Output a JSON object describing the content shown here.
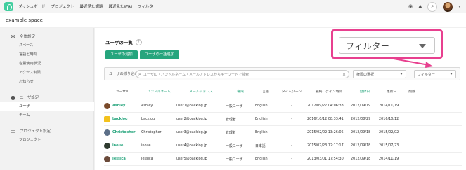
{
  "topnav": {
    "items": [
      "ダッシュボード",
      "プロジェクト",
      "最近見た課題",
      "最近見たWiki",
      "フィルタ"
    ],
    "right_icons": [
      "more-icon",
      "eye-icon",
      "bell-icon",
      "search-icon",
      "avatar"
    ]
  },
  "space": {
    "name": "example space"
  },
  "sidebar": {
    "sections": [
      {
        "label": "全体設定",
        "icon": "gear-icon",
        "items": [
          "スペース",
          "言語と時刻",
          "容量使用状況",
          "アクセス制限",
          "お知らせ"
        ]
      },
      {
        "label": "ユーザ設定",
        "icon": "user-icon",
        "items": [
          "ユーザ",
          "チーム"
        ]
      },
      {
        "label": "プロジェクト設定",
        "icon": "monitor-icon",
        "items": [
          "プロジェクト"
        ]
      }
    ],
    "active_item": "ユーザ"
  },
  "main": {
    "title": "ユーザの一覧",
    "help": "?",
    "buttons": {
      "add": "ユーザの追加",
      "bulk_add": "ユーザの一括追加"
    },
    "filter": {
      "label": "ユーザの絞り込み",
      "placeholder": "ユーザID・ハンドルネーム・メールアドレスからキーワードで検索",
      "clear": "×",
      "select1": "権限の選択",
      "select2": "フィルター"
    },
    "table": {
      "headers": [
        "ユーザID",
        "ハンドルネーム",
        "メールアドレス",
        "権限",
        "言語",
        "タイムゾーン",
        "最終ログイン時間",
        "登録日",
        "更新日",
        "削除"
      ],
      "rows": [
        [
          "Ashley",
          "Ashley",
          "user1@backlog.jp",
          "一般ユーザ",
          "English",
          "-",
          "2012/09/27 04:06:33",
          "2012/09/19",
          "2014/11/19",
          ""
        ],
        [
          "backlog",
          "backlog",
          "user2@backlog.jp",
          "管理者",
          "English",
          "-",
          "2016/10/12 08:33:41",
          "2012/08/29",
          "2016/10/12",
          ""
        ],
        [
          "Christopher",
          "Christopher",
          "user3@backlog.jp",
          "管理者",
          "English",
          "-",
          "2015/02/02 13:26:05",
          "2012/09/18",
          "2015/02/02",
          ""
        ],
        [
          "inoue",
          "inoue",
          "user4@backlog.jp",
          "一般ユーザ",
          "日本語",
          "-",
          "2015/07/23 12:17:17",
          "2012/09/18",
          "2015/07/23",
          ""
        ],
        [
          "Jessica",
          "Jessica",
          "user5@backlog.jp",
          "一般ユーザ",
          "English",
          "-",
          "2013/03/01 17:54:30",
          "2012/09/18",
          "2014/11/19",
          ""
        ]
      ]
    }
  },
  "callout": {
    "label": "フィルター"
  },
  "colors": {
    "accent": "#26a57d",
    "callout_border": "#e8408f"
  }
}
